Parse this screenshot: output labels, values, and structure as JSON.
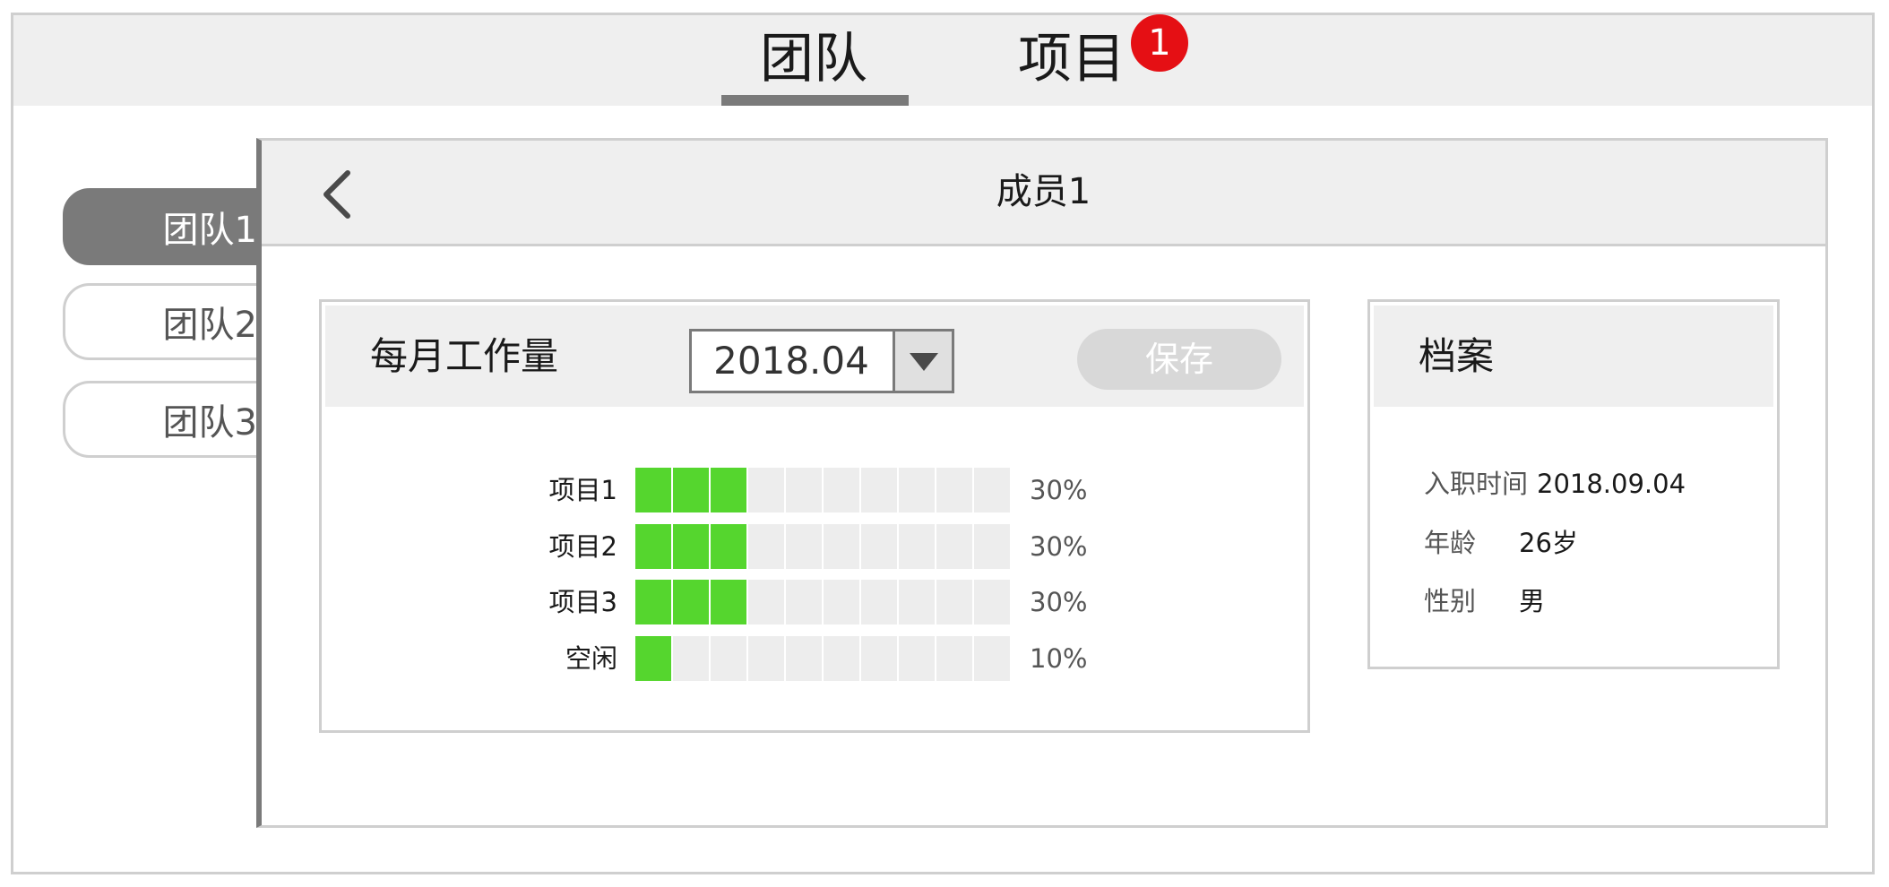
{
  "top_tabs": [
    {
      "label": "团队",
      "active": true
    },
    {
      "label": "项目",
      "badge": "1"
    }
  ],
  "sidebar": {
    "items": [
      {
        "label": "团队1",
        "active": true
      },
      {
        "label": "团队2"
      },
      {
        "label": "团队3"
      }
    ]
  },
  "panel": {
    "title": "成员1"
  },
  "workload": {
    "title": "每月工作量",
    "date_value": "2018.04",
    "save_label": "保存",
    "rows": [
      {
        "label": "项目1",
        "percent_text": "30%",
        "filled_segments": 3,
        "total_segments": 10
      },
      {
        "label": "项目2",
        "percent_text": "30%",
        "filled_segments": 3,
        "total_segments": 10
      },
      {
        "label": "项目3",
        "percent_text": "30%",
        "filled_segments": 3,
        "total_segments": 10
      },
      {
        "label": "空闲",
        "percent_text": "10%",
        "filled_segments": 1,
        "total_segments": 10
      }
    ]
  },
  "profile": {
    "title": "档案",
    "fields": [
      {
        "label": "入职时间",
        "value": "2018.09.04"
      },
      {
        "label": "年龄",
        "value": "26岁"
      },
      {
        "label": "性别",
        "value": "男"
      }
    ]
  },
  "colors": {
    "accent_green": "#55d62e",
    "badge_red": "#e50f14",
    "active_gray": "#7a7a7a"
  },
  "icons": {
    "back": "chevron-left-icon",
    "dropdown": "caret-down-icon"
  }
}
